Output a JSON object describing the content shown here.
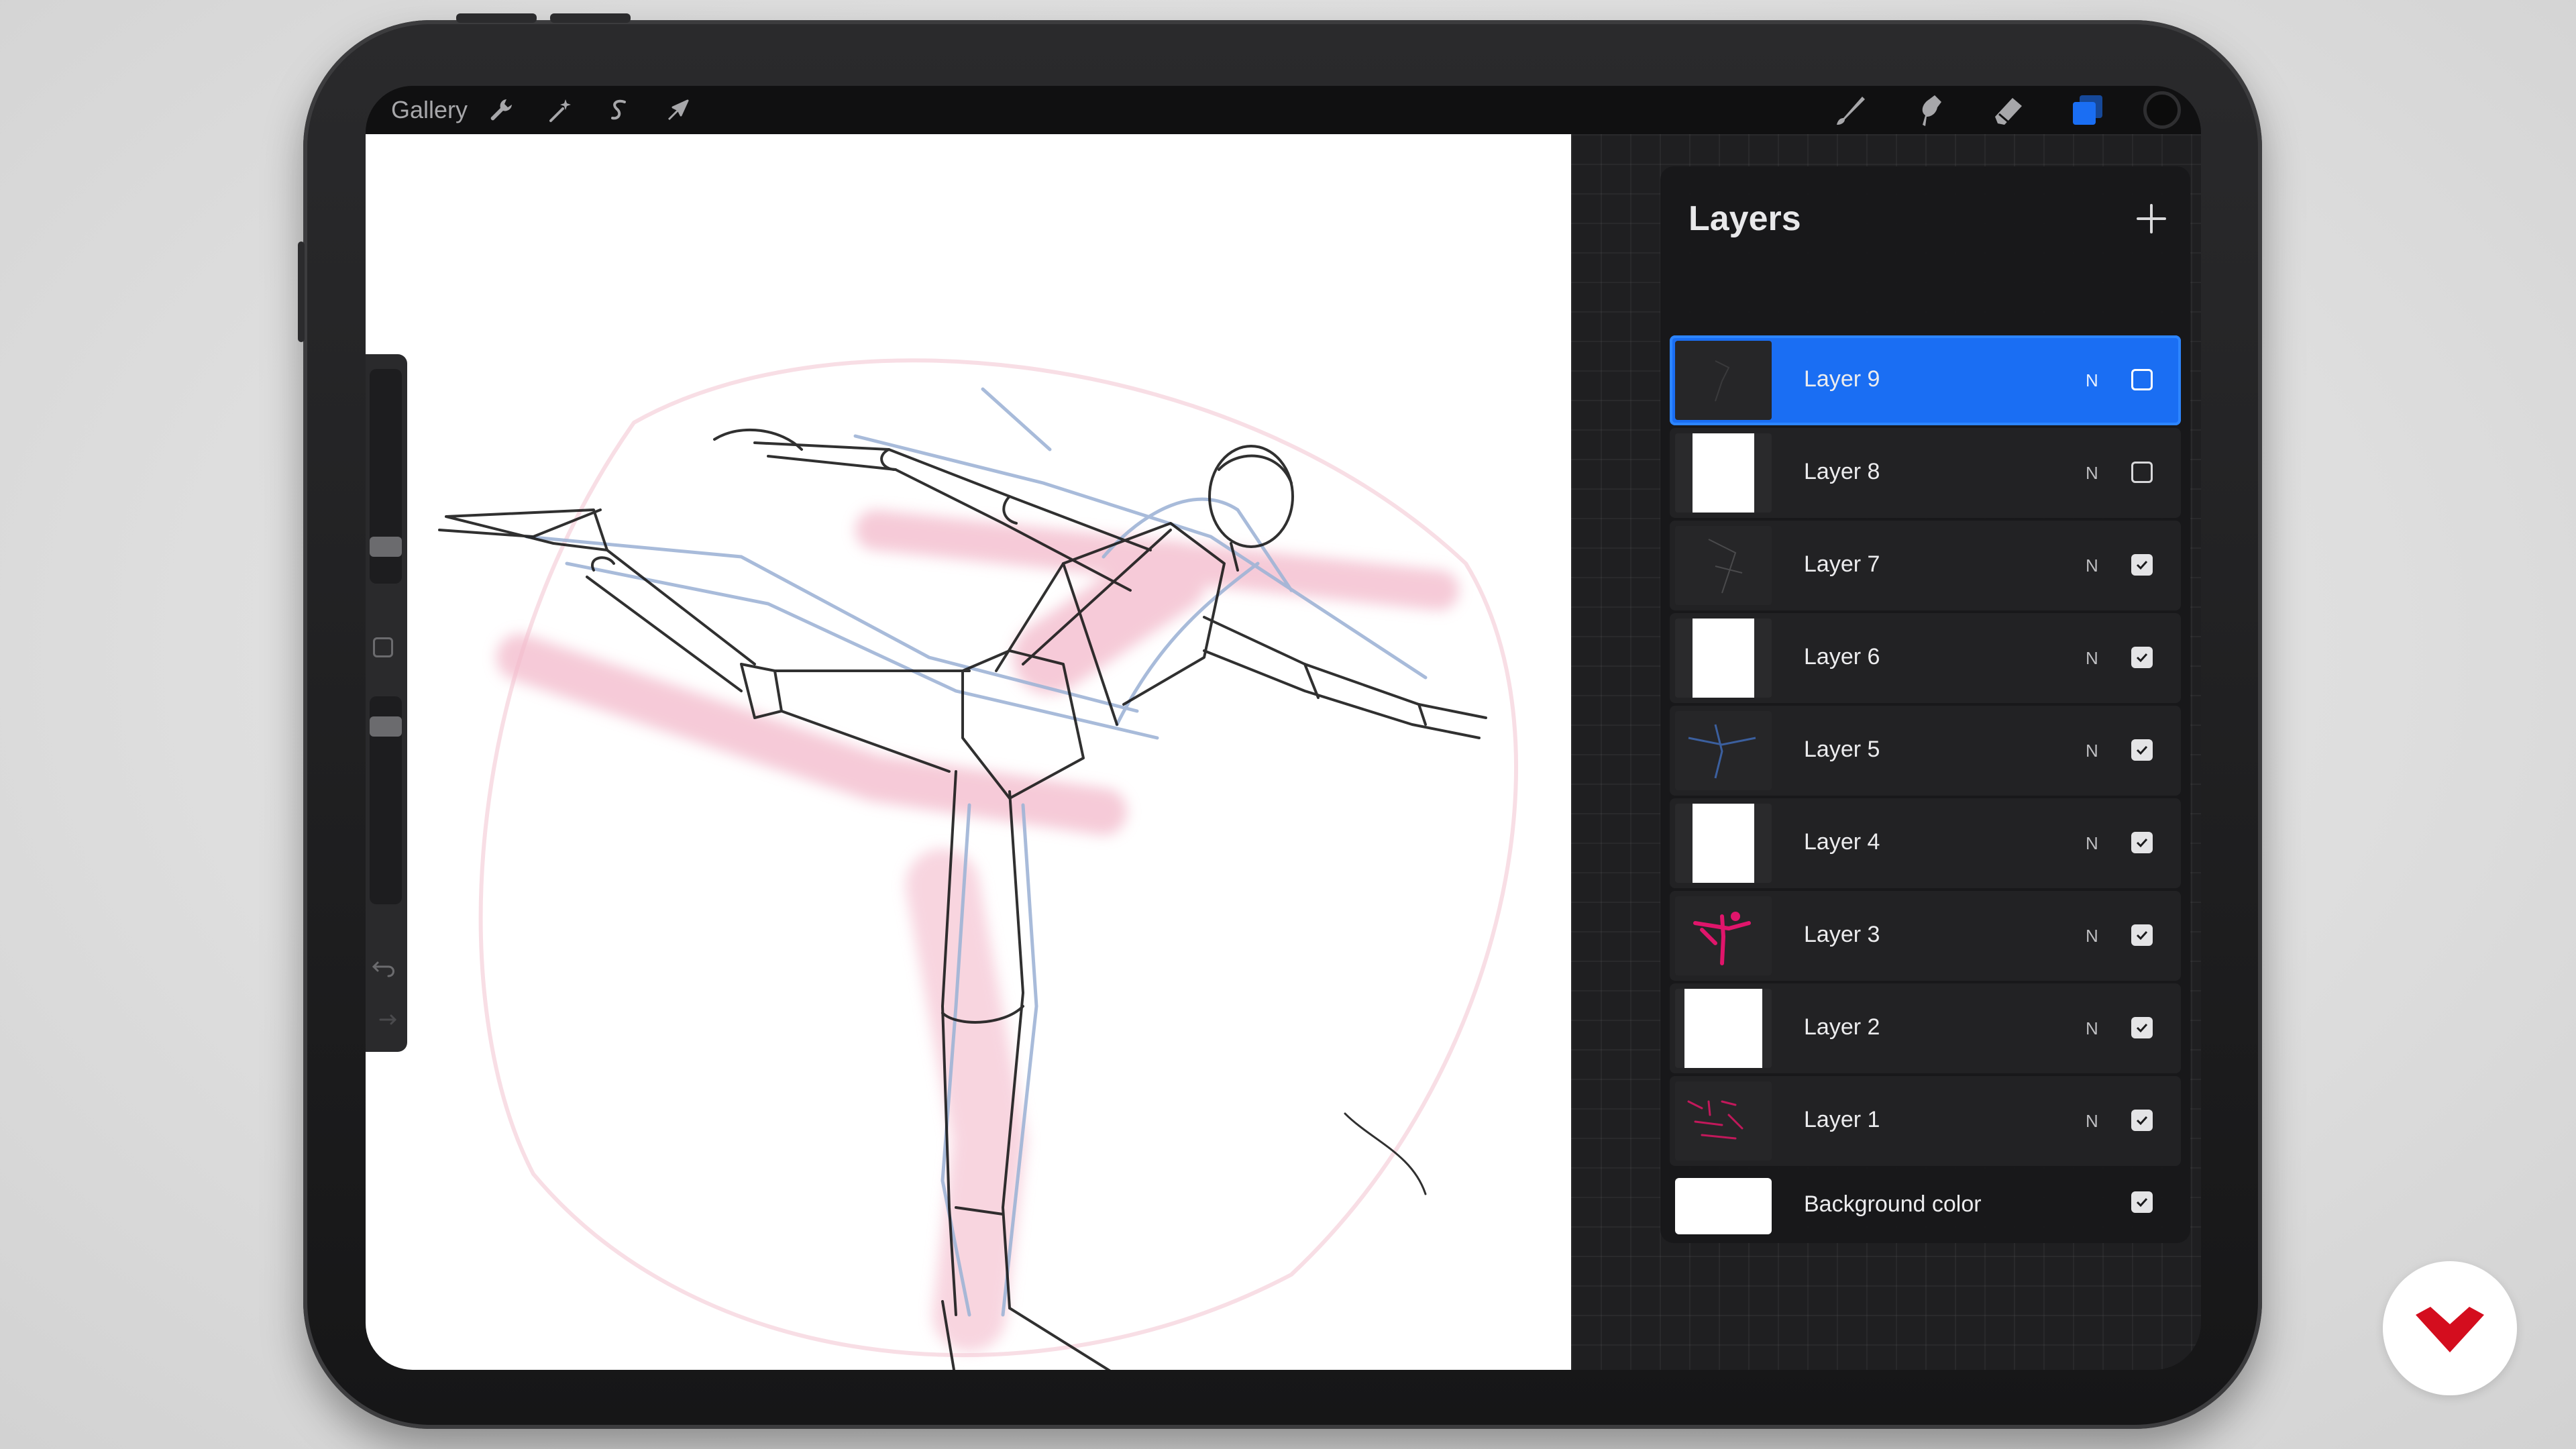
{
  "toolbar": {
    "gallery_label": "Gallery",
    "left_icons": [
      "wrench-icon",
      "magic-wand-icon",
      "selection-icon",
      "transform-icon"
    ],
    "right_icons": [
      "brush-icon",
      "smudge-icon",
      "eraser-icon",
      "layers-icon"
    ],
    "current_color": "#0c0c0c",
    "active_tool": "layers"
  },
  "layers_panel": {
    "title": "Layers",
    "layers": [
      {
        "name": "Layer 9",
        "blend": "N",
        "visible": false,
        "active": true,
        "thumb": "dark"
      },
      {
        "name": "Layer 8",
        "blend": "N",
        "visible": false,
        "active": false,
        "thumb": "white"
      },
      {
        "name": "Layer 7",
        "blend": "N",
        "visible": true,
        "active": false,
        "thumb": "dark"
      },
      {
        "name": "Layer 6",
        "blend": "N",
        "visible": true,
        "active": false,
        "thumb": "white"
      },
      {
        "name": "Layer 5",
        "blend": "N",
        "visible": true,
        "active": false,
        "thumb": "dark-blue"
      },
      {
        "name": "Layer 4",
        "blend": "N",
        "visible": true,
        "active": false,
        "thumb": "white"
      },
      {
        "name": "Layer 3",
        "blend": "N",
        "visible": true,
        "active": false,
        "thumb": "dark-pink"
      },
      {
        "name": "Layer 2",
        "blend": "N",
        "visible": true,
        "active": false,
        "thumb": "white"
      },
      {
        "name": "Layer 1",
        "blend": "N",
        "visible": true,
        "active": false,
        "thumb": "dark-pink-marks"
      }
    ],
    "background": {
      "name": "Background color",
      "visible": true,
      "color": "#ffffff"
    }
  },
  "colors": {
    "accent": "#1a6ef3",
    "sketch_pink": "#f2b8c8",
    "sketch_blue": "#9fb4d6",
    "sketch_black": "#1a1a1a"
  }
}
